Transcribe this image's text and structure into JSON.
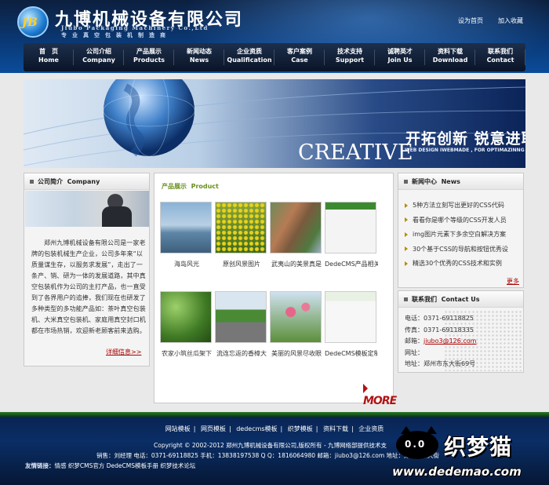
{
  "header": {
    "company_cn": "九博机械设备有限公司",
    "company_en": "Jiubo Packaging Machinery Co.,Ltd",
    "slogan": "专业真空包装机制造商",
    "logo_text": "JB",
    "set_home": "设为首页",
    "add_favorite": "加入收藏"
  },
  "nav": [
    {
      "cn": "首　页",
      "en": "Home"
    },
    {
      "cn": "公司介绍",
      "en": "Company"
    },
    {
      "cn": "产品展示",
      "en": "Products"
    },
    {
      "cn": "新闻动态",
      "en": "News"
    },
    {
      "cn": "企业资质",
      "en": "Qualification"
    },
    {
      "cn": "客户案例",
      "en": "Case"
    },
    {
      "cn": "技术支持",
      "en": "Support"
    },
    {
      "cn": "诚聘英才",
      "en": "Join Us"
    },
    {
      "cn": "资料下载",
      "en": "Download"
    },
    {
      "cn": "联系我们",
      "en": "Contact"
    }
  ],
  "banner": {
    "headline_cn": "开拓创新 锐意进取",
    "headline_en": "CREATIVE",
    "subline": "WEB DESIGN IWEBMADE , FOR OPTIMAZINNG"
  },
  "about": {
    "title_cn": "公司简介",
    "title_en": "Company",
    "text": "郑州九博机械设备有限公司是一家老牌的包装机械生产企业，公司多年来“以质量谋生存，以服务求发展”，走出了一条产、销、研为一体的发展道路，其中真空包装机作为公司的主打产品，也一直受到了各界用户的追捧，我们现在也研发了多种类型的多功能产品如：茶叶真空包装机、大米真空包装机、家庭用真空封口机都在市场热销，欢迎新老顾客前来选购。",
    "more": "详细信息>>"
  },
  "products": {
    "title_cn": "产品展示",
    "title_en": "Product",
    "more": "MORE",
    "items": [
      {
        "caption": "海岛风光",
        "img": "sea"
      },
      {
        "caption": "原创风景图片",
        "img": "flowers"
      },
      {
        "caption": "武夷山的美景真是",
        "img": "mountain"
      },
      {
        "caption": "DedeCMS产品相关",
        "img": "web"
      },
      {
        "caption": "农家小筑丝瓜架下",
        "img": "vines"
      },
      {
        "caption": "流连忘返的香樟大",
        "img": "road"
      },
      {
        "caption": "美丽的风景尽收眼",
        "img": "tulips"
      },
      {
        "caption": "DedeCMS模板定制",
        "img": "web2"
      }
    ]
  },
  "news": {
    "title_cn": "新闻中心",
    "title_en": "News",
    "items": [
      "5种方法立刻写出更好的CSS代码",
      "看看你是哪个等级的CSS开发人员",
      "img图片元素下多余空白解决方案",
      "30个基于CSS的导航和按钮优秀设",
      "精选30个优秀的CSS技术和实例"
    ],
    "more": "更多"
  },
  "contact": {
    "title_cn": "联系我们",
    "title_en": "Contact Us",
    "phone": "电话：0371-69118825",
    "fax": "传真：0371-69118335",
    "email_label": "邮箱：",
    "email": "jiubo3@126.com",
    "website": "网址：",
    "address": "地址：郑州市东大街69号"
  },
  "footer": {
    "links": [
      "网站模板",
      "网页模板",
      "dedecms模板",
      "织梦模板",
      "资料下载",
      "企业资质"
    ],
    "copyright": "Copyright © 2002-2012 郑州九博机械设备有限公司,版权所有 - 九博网络部提供技术支",
    "contact_line": "销售：刘经理 电话：0371-69118825 手机：13838197538 Q Q：1816064980 邮箱：jiubo3@126.com 地址：郑州市东大街",
    "friend_label": "友情链接：",
    "friend_links": "情感 织梦CMS官方 DedeCMS模板手册 织梦技术论坛"
  },
  "watermark": {
    "cat": "0.0",
    "brand": "织梦猫",
    "url": "www.dedemao.com"
  },
  "colors": {
    "header_dark": "#0c1f3e",
    "header_blue": "#0b4c9a",
    "product_title": "#6a8f1e",
    "link_red": "#aa0000"
  }
}
